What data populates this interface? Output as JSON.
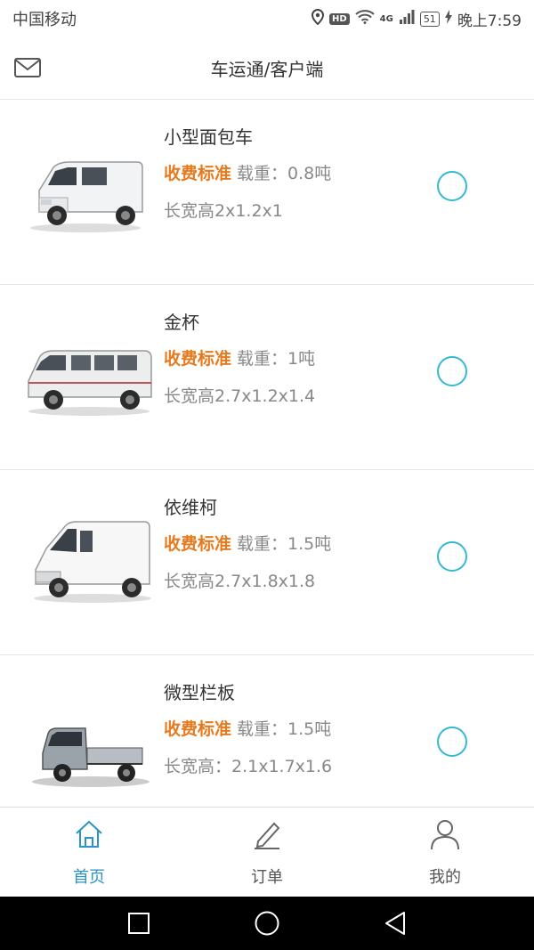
{
  "status_bar": {
    "carrier": "中国移动",
    "hd_label": "HD",
    "network_label": "4G",
    "battery": "51",
    "time": "晚上7:59"
  },
  "header": {
    "title": "车运通/客户端",
    "mail_icon": "mail-icon"
  },
  "vehicles": [
    {
      "name": "小型面包车",
      "fee_label": "收费标准",
      "load": "载重：0.8吨",
      "dims": "长宽高2x1.2x1",
      "image": "mini-van-image"
    },
    {
      "name": "金杯",
      "fee_label": "收费标准",
      "load": "载重：1吨",
      "dims": "长宽高2.7x1.2x1.4",
      "image": "jinbei-van-image"
    },
    {
      "name": "依维柯",
      "fee_label": "收费标准",
      "load": "载重：1.5吨",
      "dims": "长宽高2.7x1.8x1.8",
      "image": "iveco-van-image"
    },
    {
      "name": "微型栏板",
      "fee_label": "收费标准",
      "load": "载重：1.5吨",
      "dims": "长宽高：2.1x1.7x1.6",
      "image": "mini-truck-image"
    }
  ],
  "tabs": [
    {
      "label": "首页",
      "icon": "home-icon",
      "active": true
    },
    {
      "label": "订单",
      "icon": "pencil-icon",
      "active": false
    },
    {
      "label": "我的",
      "icon": "user-icon",
      "active": false
    }
  ],
  "colors": {
    "accent": "#2a93c9",
    "fee": "#e87a1e",
    "radio": "#35b8d3"
  }
}
